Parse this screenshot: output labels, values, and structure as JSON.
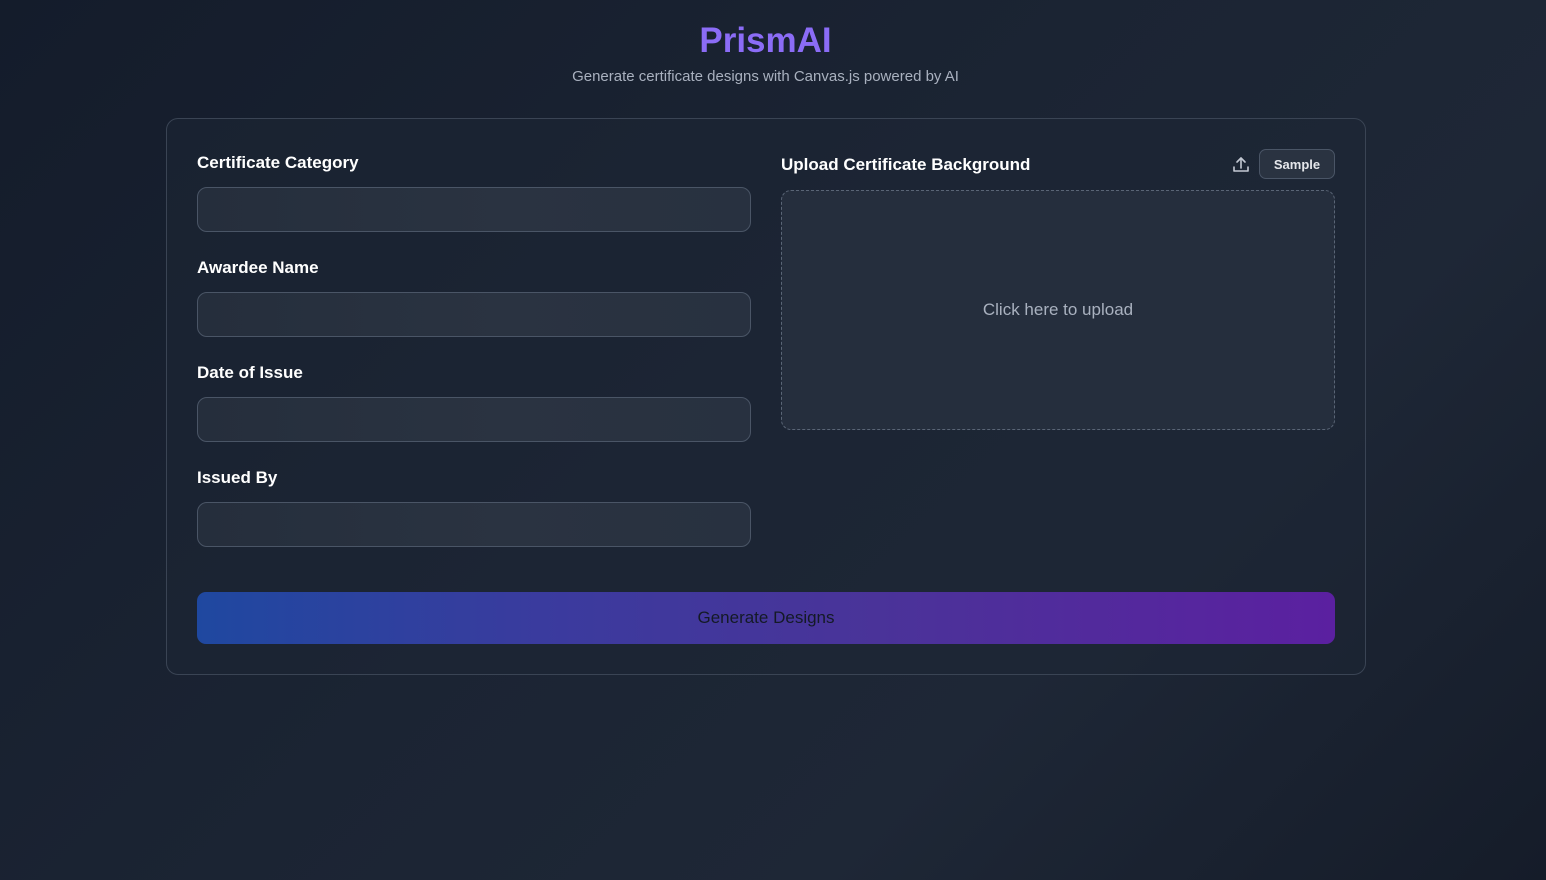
{
  "app": {
    "title": "PrismAI",
    "subtitle": "Generate certificate designs with Canvas.js powered by AI"
  },
  "form": {
    "fields": [
      {
        "label": "Certificate Category",
        "value": "",
        "placeholder": ""
      },
      {
        "label": "Awardee Name",
        "value": "",
        "placeholder": ""
      },
      {
        "label": "Date of Issue",
        "value": "",
        "placeholder": ""
      },
      {
        "label": "Issued By",
        "value": "",
        "placeholder": ""
      }
    ]
  },
  "upload": {
    "label": "Upload Certificate Background",
    "icon": "upload-icon",
    "sample_label": "Sample",
    "hint": "Click here to upload"
  },
  "actions": {
    "generate_label": "Generate Designs"
  },
  "colors": {
    "accent": "#8b6cf6",
    "button_gradient_start": "#1f48a0",
    "button_gradient_end": "#5b20a0",
    "background": "#1b2433"
  }
}
